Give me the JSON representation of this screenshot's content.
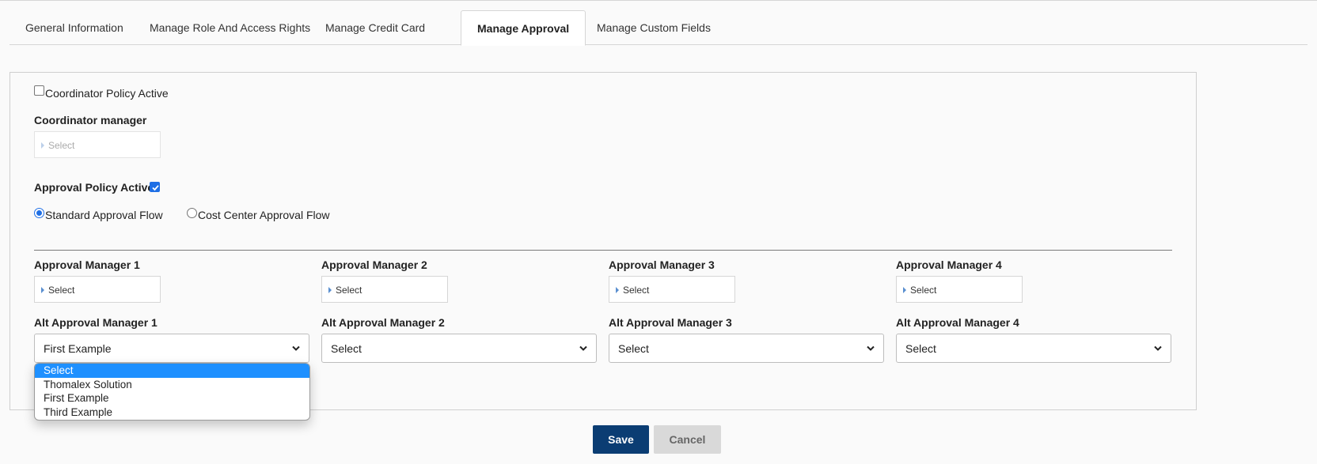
{
  "tabs": [
    {
      "label": "General Information",
      "active": false
    },
    {
      "label": "Manage Role And Access Rights",
      "active": false
    },
    {
      "label": "Manage Credit Card",
      "active": false
    },
    {
      "label": "Manage Approval",
      "active": true
    },
    {
      "label": "Manage Custom Fields",
      "active": false
    }
  ],
  "coordinator": {
    "policy_label": "Coordinator Policy Active",
    "policy_checked": false,
    "manager_label": "Coordinator manager",
    "manager_select": "Select"
  },
  "approval": {
    "policy_label": "Approval Policy Active",
    "policy_checked": true,
    "flow_standard": "Standard Approval Flow",
    "flow_cost_center": "Cost Center Approval Flow",
    "selected_flow": "standard"
  },
  "managers": [
    {
      "label": "Approval Manager 1",
      "value": "Select"
    },
    {
      "label": "Approval Manager 2",
      "value": "Select"
    },
    {
      "label": "Approval Manager 3",
      "value": "Select"
    },
    {
      "label": "Approval Manager 4",
      "value": "Select"
    }
  ],
  "alt_managers": [
    {
      "label": "Alt Approval Manager 1",
      "value": "First Example"
    },
    {
      "label": "Alt Approval Manager 2",
      "value": "Select"
    },
    {
      "label": "Alt Approval Manager 3",
      "value": "Select"
    },
    {
      "label": "Alt Approval Manager 4",
      "value": "Select"
    }
  ],
  "dropdown_options": [
    "Select",
    "Thomalex Solution",
    "First Example",
    "Third Example"
  ],
  "dropdown_highlighted": "Select",
  "buttons": {
    "save": "Save",
    "cancel": "Cancel"
  },
  "colors": {
    "accent": "#1f6fe5",
    "save_bg": "#0b3d73",
    "highlight": "#1e90ff"
  }
}
